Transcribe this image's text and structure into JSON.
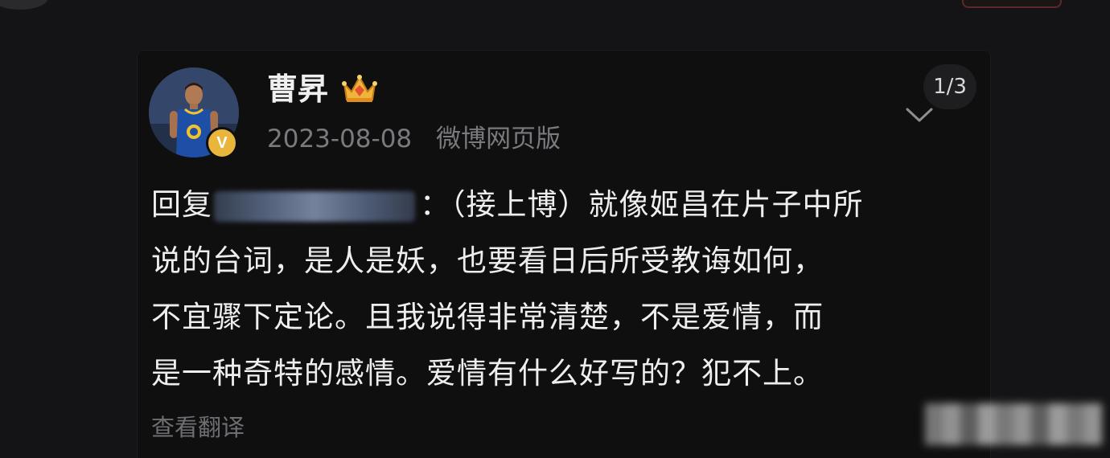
{
  "post": {
    "username": "曹昇",
    "date": "2023-08-08",
    "source": "微博网页版",
    "page_counter": "1/3",
    "verified_badge": "V",
    "body_lines": [
      {
        "prefix": "回复",
        "suffix": "：（接上博）就像姬昌在片子中所"
      },
      {
        "text": "说的台词，是人是妖，也要看日后所受教诲如何，"
      },
      {
        "text": "不宜骤下定论。且我说得非常清楚，不是爱情，而"
      },
      {
        "text": "是一种奇特的感情。爱情有什么好写的？犯不上。"
      }
    ],
    "translate_label": "查看翻译"
  },
  "icons": {
    "avatar": "avatar-photo",
    "verified": "verified-icon",
    "membership": "crown-icon",
    "expand": "chevron-down-icon"
  },
  "colors": {
    "background": "#141416",
    "card": "#0f0f10",
    "text_primary": "#eeeeee",
    "text_secondary": "#7a7a7e",
    "badge_gold": "#e9b53a"
  }
}
